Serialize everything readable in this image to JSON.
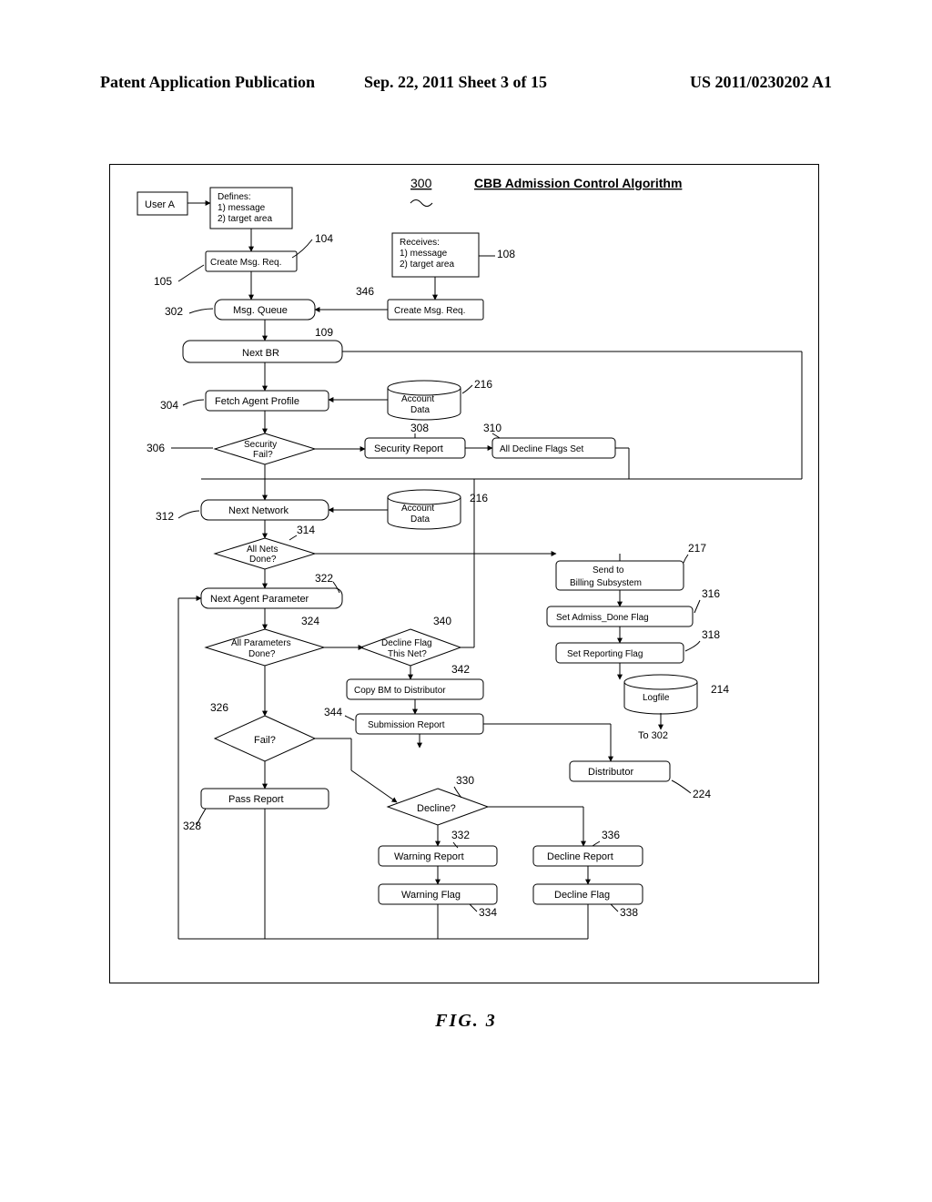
{
  "header": {
    "left": "Patent Application Publication",
    "center": "Sep. 22, 2011  Sheet 3 of 15",
    "right": "US 2011/0230202 A1"
  },
  "diagram": {
    "refnum": "300",
    "title": "CBB Admission Control Algorithm",
    "userA": "User A",
    "defines": {
      "title": "Defines:",
      "l1": "1) message",
      "l2": "2) target area"
    },
    "receives": {
      "title": "Receives:",
      "l1": "1) message",
      "l2": "2) target area"
    },
    "create_msg_req": "Create Msg. Req.",
    "msg_queue": "Msg. Queue",
    "next_br": "Next BR",
    "fetch_agent_profile": "Fetch Agent Profile",
    "account_data": "Account Data",
    "security_fail": "Security Fail?",
    "security_report": "Security Report",
    "all_decline_flags_set": "All Decline Flags Set",
    "next_network": "Next Network",
    "all_nets_done": "All Nets Done?",
    "next_agent_parameter": "Next Agent Parameter",
    "all_parameters_done": "All Parameters Done?",
    "decline_flag_this_net": "Decline Flag This Net?",
    "copy_bm": "Copy BM to Distributor",
    "submission_report": "Submission Report",
    "fail": "Fail?",
    "pass_report": "Pass Report",
    "decline": "Decline?",
    "warning_report": "Warning Report",
    "warning_flag": "Warning Flag",
    "decline_report": "Decline Report",
    "decline_flag": "Decline Flag",
    "send_billing": "Send to Billing Subsystem",
    "set_admiss": "Set Admiss_Done Flag",
    "set_reporting": "Set Reporting Flag",
    "logfile": "Logfile",
    "to302": "To 302",
    "distributor": "Distributor",
    "labels": {
      "l104": "104",
      "l105": "105",
      "l108": "108",
      "l109": "109",
      "l216a": "216",
      "l216b": "216",
      "l217": "217",
      "l214": "214",
      "l224": "224",
      "l302": "302",
      "l304": "304",
      "l306": "306",
      "l308": "308",
      "l310": "310",
      "l312": "312",
      "l314": "314",
      "l316": "316",
      "l318": "318",
      "l322": "322",
      "l324": "324",
      "l326": "326",
      "l328": "328",
      "l330": "330",
      "l332": "332",
      "l334": "334",
      "l336": "336",
      "l338": "338",
      "l340": "340",
      "l342": "342",
      "l344": "344",
      "l346": "346"
    }
  },
  "caption": "FIG. 3"
}
